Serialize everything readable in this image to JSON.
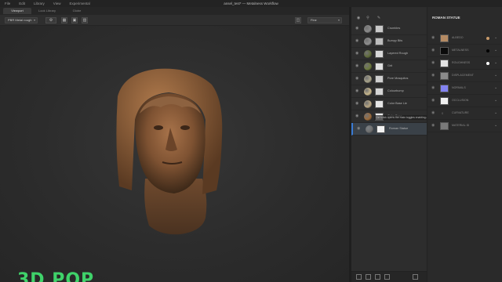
{
  "menu": [
    "File",
    "Edit",
    "Library",
    "View",
    "Experimental"
  ],
  "window_title": "ansel_test* — Metalness Workflow",
  "viewport_tabs": [
    "Viewport",
    "Look Library",
    "Globe"
  ],
  "toolbar": {
    "mode_select": "PBR Metal rough",
    "view_select": "Fine"
  },
  "panel_tabs": [
    "Layers",
    "Scene",
    "Shading",
    "Performance",
    "Export"
  ],
  "layers": [
    {
      "name": "Crumbles",
      "sphere": "#8a8a8a",
      "thumb": "#c9c9c9"
    },
    {
      "name": "Bumpy Bits",
      "sphere": "#8f8f8f",
      "thumb": "#bdbdbd"
    },
    {
      "name": "Layered Rough",
      "sphere": "#5f6b3a",
      "thumb": "#d8d8d8"
    },
    {
      "name": "Grit",
      "sphere": "#6d7a3d",
      "thumb": "#e0e0e0"
    },
    {
      "name": "Pore Mosquitos",
      "sphere": "#a8a38a",
      "thumb": "#cfcfcf"
    },
    {
      "name": "Colourbump",
      "sphere": "#c8b78c",
      "thumb": "#d5d5d5"
    },
    {
      "name": "Color Base Lie",
      "sphere": "#b8a683",
      "thumb": "#e6e6e6"
    },
    {
      "name": "Color Base",
      "sphere": "#9b6a3a",
      "thumb": "#e9e9e9"
    },
    {
      "name": "Roman Statue",
      "sphere": "#6e6e6e",
      "thumb": "#f2f2f2"
    }
  ],
  "tooltip": "Ctrl+click opens the main toggles enabling all checkbox layers",
  "properties": {
    "title": "ROMAN STATUE",
    "channels": [
      {
        "name": "ALBEDO",
        "swatch": "#b48a63",
        "dot": "#c89a6a"
      },
      {
        "name": "METALNESS",
        "swatch": "#0a0a0a",
        "dot": "#000000"
      },
      {
        "name": "ROUGHNESS",
        "swatch": "#e2e2e2",
        "dot": "#ffffff"
      },
      {
        "name": "DISPLACEMENT",
        "swatch": "#8a8a8a",
        "dot": ""
      },
      {
        "name": "NORMALS",
        "swatch": "#8282f0",
        "dot": ""
      },
      {
        "name": "OCCLUSION",
        "swatch": "#f0f0f0",
        "dot": ""
      },
      {
        "name": "CURVATURE",
        "swatch": "",
        "dot": "",
        "number": "0"
      },
      {
        "name": "MATERIAL ID",
        "swatch": "#7a7a7a",
        "dot": ""
      }
    ]
  },
  "brand": "3D POP",
  "colors": {
    "accent": "#3a7bd5",
    "brand": "#3fd26a"
  }
}
